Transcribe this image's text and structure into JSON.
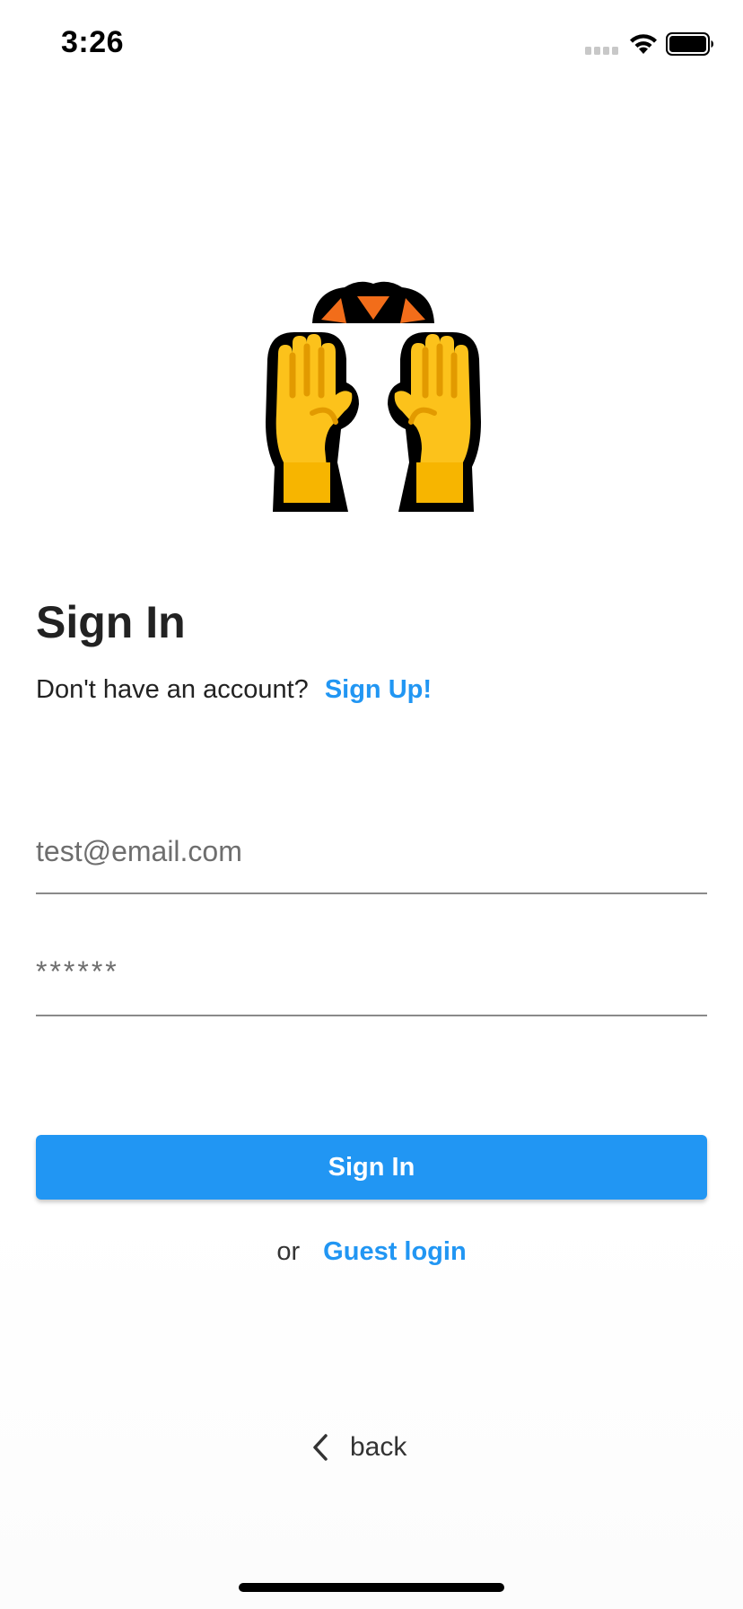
{
  "status_bar": {
    "time": "3:26"
  },
  "hero": {
    "icon": "raising-hands-emoji"
  },
  "signin": {
    "title": "Sign In",
    "no_account_prompt": "Don't have an account?",
    "signup_link": "Sign Up!",
    "email_placeholder": "test@email.com",
    "email_value": "",
    "password_placeholder": "******",
    "password_value": "",
    "submit_label": "Sign In",
    "or_text": "or",
    "guest_link": "Guest login",
    "back_label": "back"
  },
  "colors": {
    "accent": "#2196f3",
    "text": "#222222",
    "underline": "#8a8a8a"
  }
}
